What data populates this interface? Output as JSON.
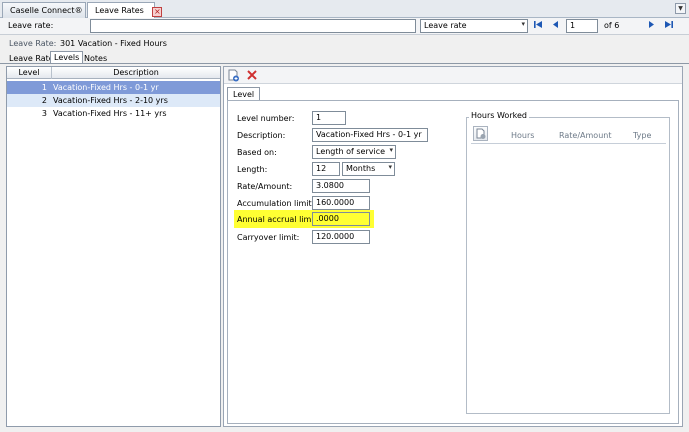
{
  "doc_tabs": [
    {
      "label": "Caselle Connect®",
      "active": false
    },
    {
      "label": "Leave Rates",
      "active": true
    }
  ],
  "toolbar": {
    "leave_rate_label": "Leave rate:",
    "leave_rate_value": "",
    "lookup_select": "Leave rate",
    "record_number": "1",
    "record_of": "of 6"
  },
  "current_record": {
    "label": "Leave Rate:",
    "value": "301  Vacation - Fixed Hours"
  },
  "sub_tabs": [
    {
      "label": "Leave Rate",
      "active": false
    },
    {
      "label": "Levels",
      "active": true
    },
    {
      "label": "Notes",
      "active": false
    }
  ],
  "grid": {
    "columns": [
      "Level",
      "Description"
    ],
    "rows": [
      {
        "level": "1",
        "description": "Vacation-Fixed Hrs - 0-1 yr",
        "state": "selected"
      },
      {
        "level": "2",
        "description": "Vacation-Fixed Hrs - 2-10 yrs",
        "state": "alt"
      },
      {
        "level": "3",
        "description": "Vacation-Fixed Hrs - 11+ yrs",
        "state": "normal"
      }
    ]
  },
  "level_form": {
    "tab_label": "Level",
    "level_number_label": "Level number:",
    "level_number": "1",
    "description_label": "Description:",
    "description": "Vacation-Fixed Hrs - 0-1 yr",
    "based_on_label": "Based on:",
    "based_on": "Length of service",
    "length_label": "Length:",
    "length": "12",
    "length_unit": "Months",
    "rate_label": "Rate/Amount:",
    "rate": "3.0800",
    "accum_label": "Accumulation limit:",
    "accum": "160.0000",
    "annual_label": "Annual accrual limit:",
    "annual": ".0000",
    "carryover_label": "Carryover limit:",
    "carryover": "120.0000"
  },
  "hours_worked": {
    "title": "Hours Worked",
    "columns": [
      "Hours",
      "Rate/Amount",
      "Type"
    ]
  },
  "colors": {
    "selected_row": "#7f9ad8",
    "alt_row": "#dde9f8",
    "highlight": "#ffff33",
    "nav_blue": "#1e58b4",
    "delete_red": "#d03030"
  },
  "icons": {
    "new_record": "new-record-icon",
    "delete": "delete-icon",
    "first": "first-record-icon",
    "prev": "prev-record-icon",
    "next": "next-record-icon",
    "last": "last-record-icon"
  }
}
